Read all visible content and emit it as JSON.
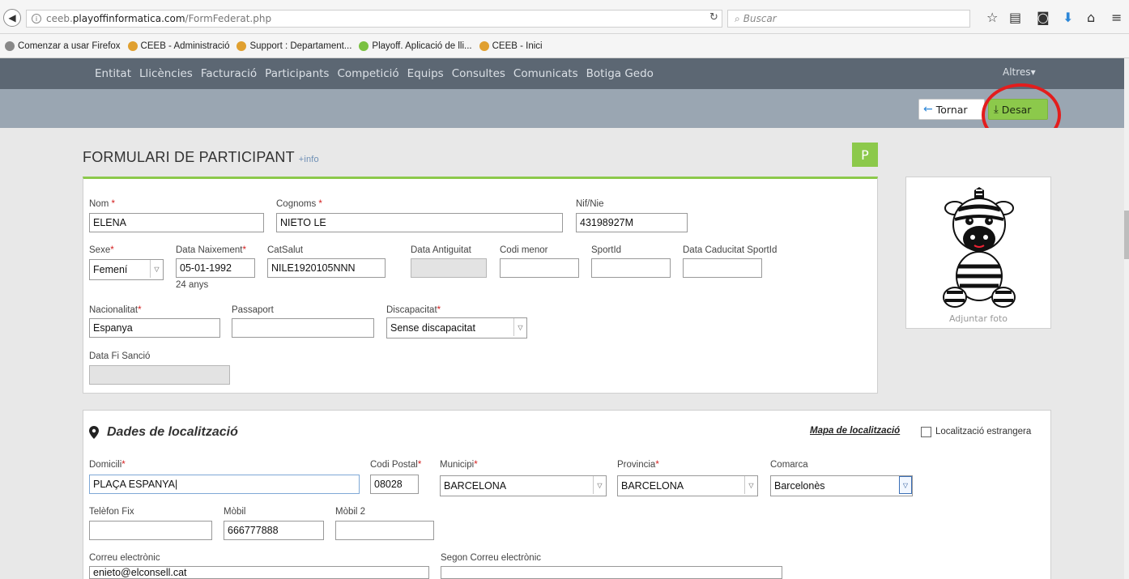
{
  "browser": {
    "url_prefix": "ceeb.",
    "url_host": "playoffinformatica.com",
    "url_path": "/FormFederat.php",
    "search_placeholder": "Buscar",
    "bookmarks": [
      {
        "label": "Comenzar a usar Firefox",
        "color": "#888888"
      },
      {
        "label": "CEEB - Administració",
        "color": "#e0a030"
      },
      {
        "label": "Support : Departament...",
        "color": "#e0a030"
      },
      {
        "label": "Playoff. Aplicació de lli...",
        "color": "#7ac142"
      },
      {
        "label": "CEEB - Inici",
        "color": "#e0a030"
      }
    ]
  },
  "nav": {
    "items": [
      "Entitat",
      "Llicències",
      "Facturació",
      "Participants",
      "Competició",
      "Equips",
      "Consultes",
      "Comunicats",
      "Botiga Gedo"
    ],
    "altres": "Altres"
  },
  "toolbar": {
    "back_label": "Tornar",
    "save_label": "Desar"
  },
  "form": {
    "title": "FORMULARI DE PARTICIPANT",
    "more_info": "+info",
    "badge": "P",
    "photo_caption": "Adjuntar foto",
    "fields": {
      "nom": {
        "label": "Nom",
        "value": "ELENA"
      },
      "cognoms": {
        "label": "Cognoms",
        "value": "NIETO LE"
      },
      "nif": {
        "label": "Nif/Nie",
        "value": "43198927M"
      },
      "sexe": {
        "label": "Sexe",
        "value": "Femení"
      },
      "data_naixement": {
        "label": "Data Naixement",
        "value": "05-01-1992",
        "age_note": "24 anys"
      },
      "catsalut": {
        "label": "CatSalut",
        "value": "NILE1920105NNN"
      },
      "data_antiguitat": {
        "label": "Data Antiguitat",
        "value": ""
      },
      "codi_menor": {
        "label": "Codi menor",
        "value": ""
      },
      "sportid": {
        "label": "SportId",
        "value": ""
      },
      "data_caducitat": {
        "label": "Data Caducitat SportId",
        "value": ""
      },
      "nacionalitat": {
        "label": "Nacionalitat",
        "value": "Espanya"
      },
      "passaport": {
        "label": "Passaport",
        "value": ""
      },
      "discapacitat": {
        "label": "Discapacitat",
        "value": "Sense discapacitat"
      },
      "data_fi_sancio": {
        "label": "Data Fi Sanció",
        "value": ""
      }
    }
  },
  "localitzacio": {
    "title": "Dades de localització",
    "map_link": "Mapa de localització",
    "foreign_label": "Localització estrangera",
    "fields": {
      "domicili": {
        "label": "Domicili",
        "value": "PLAÇA ESPANYA"
      },
      "codi_postal": {
        "label": "Codi Postal",
        "value": "08028"
      },
      "municipi": {
        "label": "Municipi",
        "value": "BARCELONA"
      },
      "provincia": {
        "label": "Provincia",
        "value": "BARCELONA"
      },
      "comarca": {
        "label": "Comarca",
        "value": "Barcelonès"
      },
      "telefon_fix": {
        "label": "Telèfon Fix",
        "value": ""
      },
      "mobil": {
        "label": "Mòbil",
        "value": "666777888"
      },
      "mobil2": {
        "label": "Mòbil 2",
        "value": ""
      },
      "correu": {
        "label": "Correu electrònic",
        "value": "enieto@elconsell.cat"
      },
      "segon_correu": {
        "label": "Segon Correu electrònic",
        "value": ""
      }
    }
  },
  "colors": {
    "accent_green": "#8cc94b",
    "nav_bg": "#5c6773",
    "toolbar_bg": "#9aa6b2",
    "highlight_red": "#e31d1d"
  }
}
